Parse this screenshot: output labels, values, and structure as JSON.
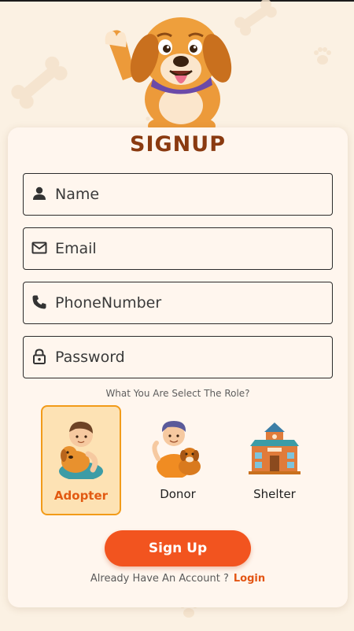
{
  "form": {
    "title": "SIGNUP",
    "fields": [
      {
        "placeholder": "Name",
        "icon": "person-icon"
      },
      {
        "placeholder": "Email",
        "icon": "mail-icon"
      },
      {
        "placeholder": "PhoneNumber",
        "icon": "phone-icon"
      },
      {
        "placeholder": "Password",
        "icon": "lock-icon"
      }
    ],
    "role_question": "What You Are Select The Role?",
    "roles": [
      {
        "label": "Adopter",
        "selected": true
      },
      {
        "label": "Donor",
        "selected": false
      },
      {
        "label": "Shelter",
        "selected": false
      }
    ],
    "submit_label": "Sign Up",
    "footer_text": "Already Have An Account ?",
    "login_label": "Login"
  },
  "colors": {
    "background": "#fbf1e3",
    "card": "#fff6ee",
    "title": "#8a3a10",
    "accent": "#f2541f",
    "selected_border": "#f29b19",
    "selected_fill": "#fde2b4"
  }
}
